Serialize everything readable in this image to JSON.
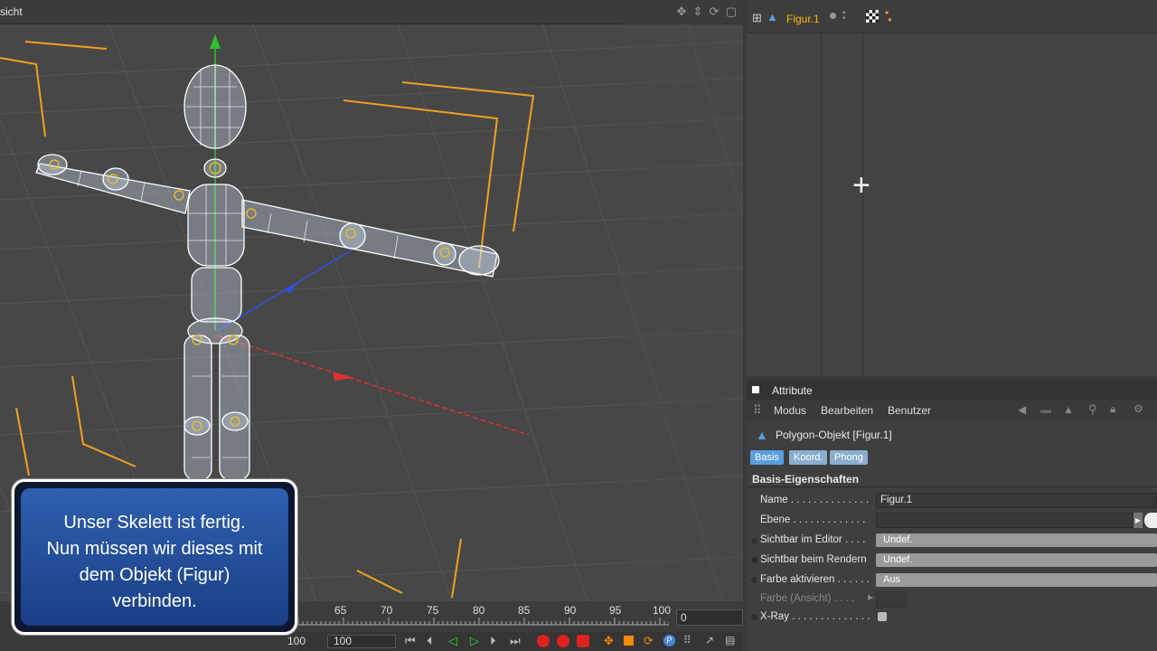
{
  "viewport": {
    "title": "sicht"
  },
  "object_manager": {
    "object_name": "Figur.1"
  },
  "attributes": {
    "panel_title": "Attribute",
    "menus": [
      "Modus",
      "Bearbeiten",
      "Benutzer"
    ],
    "object_title": "Polygon-Objekt [Figur.1]",
    "tabs": [
      "Basis",
      "Koord.",
      "Phong"
    ],
    "section_title": "Basis-Eigenschaften",
    "rows": {
      "name": {
        "label": "Name . . . . . . . . . . . . . .",
        "value": "Figur.1"
      },
      "ebene": {
        "label": "Ebene . . . . . . . . . . . . .",
        "value": ""
      },
      "sichtbar_editor": {
        "label": "Sichtbar im Editor . . . .",
        "value": "Undef."
      },
      "sichtbar_render": {
        "label": "Sichtbar beim Rendern",
        "value": "Undef."
      },
      "farbe_aktivieren": {
        "label": "Farbe aktivieren . . . . . .",
        "value": "Aus"
      },
      "farbe_ansicht": {
        "label": "Farbe (Ansicht) . . . .",
        "value": ""
      },
      "xray": {
        "label": "X-Ray . . . . . . . . . . . . . ."
      }
    }
  },
  "timeline": {
    "ticks": [
      "65",
      "70",
      "75",
      "80",
      "85",
      "90",
      "95",
      "100"
    ],
    "current_frame": "0",
    "end_frame": "100",
    "left_field": "100"
  },
  "tooltip": {
    "lines": [
      "Unser Skelett ist fertig.",
      "Nun müssen wir dieses mit",
      "dem Objekt (Figur)",
      "verbinden."
    ]
  },
  "colors": {
    "accent_blue": "#5a9ee0",
    "object_orange": "#ffb400",
    "axis_x": "#e03030",
    "axis_y": "#30c030",
    "axis_z": "#3050e0"
  }
}
